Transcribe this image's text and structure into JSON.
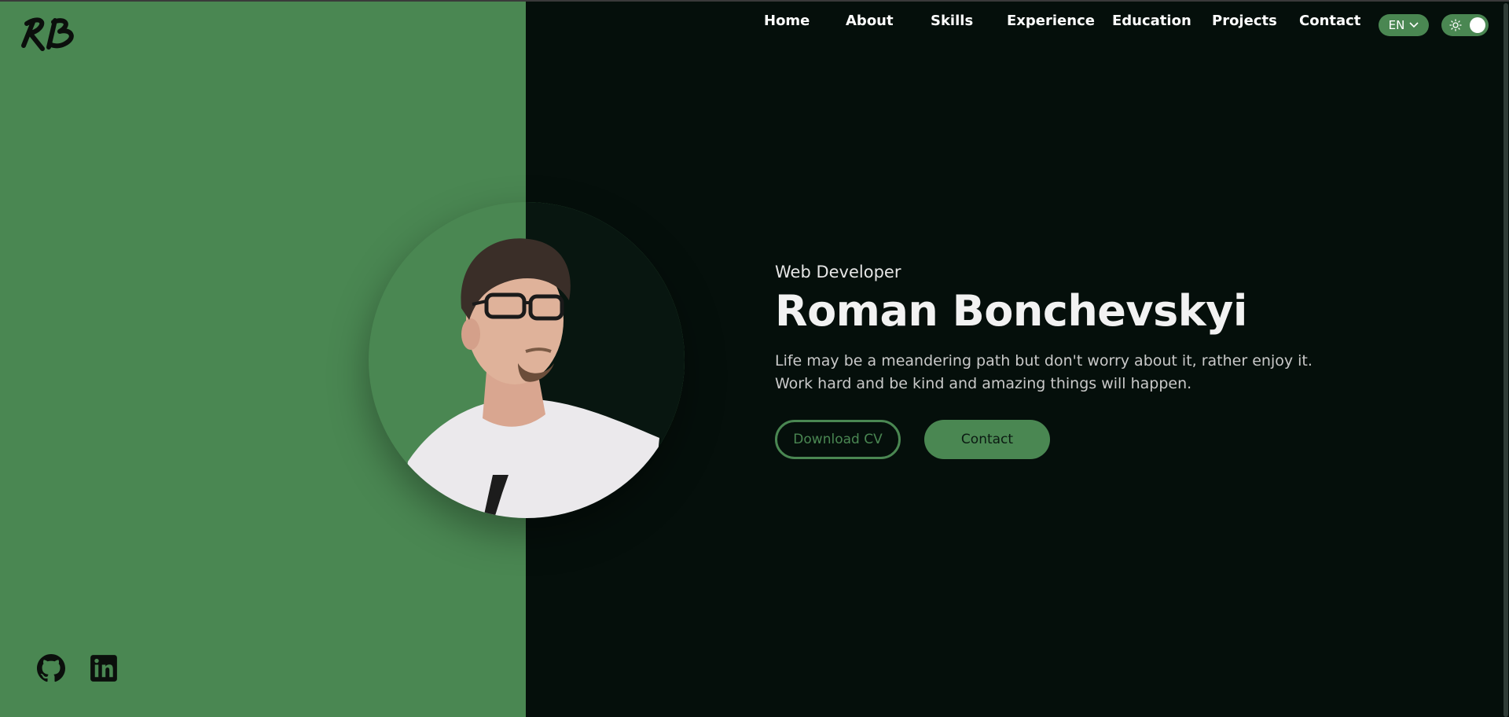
{
  "brand": {
    "logo_text": "RB"
  },
  "nav": {
    "items": [
      {
        "label": "Home"
      },
      {
        "label": "About"
      },
      {
        "label": "Skills"
      },
      {
        "label": "Experience"
      },
      {
        "label": "Education"
      },
      {
        "label": "Projects"
      },
      {
        "label": "Contact"
      }
    ],
    "language": "EN",
    "theme_toggle_icon": "sun-icon"
  },
  "hero": {
    "subtitle": "Web Developer",
    "name": "Roman Bonchevskyi",
    "description": "Life may be a meandering path but don't worry about it, rather enjoy it. Work hard and be kind and amazing things will happen.",
    "download_button": "Download CV",
    "contact_button": "Contact"
  },
  "social": [
    {
      "icon": "github-icon"
    },
    {
      "icon": "linkedin-icon"
    }
  ],
  "colors": {
    "accent": "#4a8752",
    "background_dark": "#050f0b",
    "text_light": "#f2f2f2"
  }
}
